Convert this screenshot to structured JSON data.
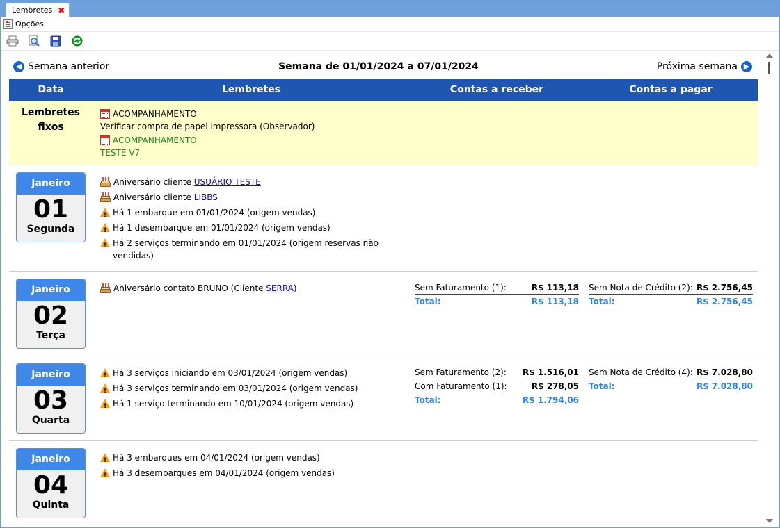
{
  "tab": {
    "label": "Lembretes"
  },
  "menu": {
    "options_label": "Opções"
  },
  "toolbar": {
    "buttons": [
      "print-icon",
      "preview-icon",
      "save-icon",
      "refresh-icon"
    ]
  },
  "nav": {
    "prev_label": "Semana anterior",
    "next_label": "Próxima semana",
    "week_title": "Semana de 01/01/2024 a 07/01/2024"
  },
  "columns": {
    "date": "Data",
    "reminders": "Lembretes",
    "receivables": "Contas a receber",
    "payables": "Contas a pagar"
  },
  "fixed": {
    "label": "Lembretes fixos",
    "items": [
      {
        "title": "ACOMPANHAMENTO",
        "text": "Verificar compra de papel impressora (Observador)"
      },
      {
        "title": "ACOMPANHAMENTO",
        "text": "TESTE V7"
      }
    ]
  },
  "days": [
    {
      "month": "Janeiro",
      "day": "01",
      "weekday": "Segunda",
      "items": [
        {
          "pre": "Aniversário cliente ",
          "link": "USUÁRIO TESTE",
          "post": ""
        },
        {
          "pre": "Aniversário cliente ",
          "link": "LIBBS",
          "post": ""
        },
        {
          "pre": "Há 1 embarque em 01/01/2024 (origem vendas)"
        },
        {
          "pre": "Há 1 desembarque em 01/01/2024 (origem vendas)"
        },
        {
          "pre": "Há 2 serviços terminando em 01/01/2024 (origem reservas não vendidas)"
        }
      ]
    },
    {
      "month": "Janeiro",
      "day": "02",
      "weekday": "Terça",
      "items": [
        {
          "pre": "Aniversário contato BRUNO (Cliente ",
          "link": "SERRA",
          "post": ")"
        }
      ],
      "receivables": [
        {
          "label": "Sem Faturamento (1):",
          "value": "R$ 113,18"
        }
      ],
      "receivables_total": "R$ 113,18",
      "payables": [
        {
          "label": "Sem Nota de Crédito (2):",
          "value": "R$ 2.756,45"
        }
      ],
      "payables_total": "R$ 2.756,45"
    },
    {
      "month": "Janeiro",
      "day": "03",
      "weekday": "Quarta",
      "items": [
        {
          "pre": "Há 3 serviços iniciando em 03/01/2024 (origem vendas)"
        },
        {
          "pre": "Há 3 serviços terminando em 03/01/2024 (origem vendas)"
        },
        {
          "pre": "Há 1 serviço terminando em 10/01/2024 (origem vendas)"
        }
      ],
      "receivables": [
        {
          "label": "Sem Faturamento (2):",
          "value": "R$ 1.516,01"
        },
        {
          "label": "Com Faturamento (1):",
          "value": "R$ 278,05"
        }
      ],
      "receivables_total": "R$ 1.794,06",
      "payables": [
        {
          "label": "Sem Nota de Crédito (4):",
          "value": "R$ 7.028,80"
        }
      ],
      "payables_total": "R$ 7.028,80"
    },
    {
      "month": "Janeiro",
      "day": "04",
      "weekday": "Quinta",
      "items": [
        {
          "pre": "Há 3 embarques em 04/01/2024 (origem vendas)"
        },
        {
          "pre": "Há 3 desembarques em 04/01/2024 (origem vendas)"
        }
      ]
    }
  ],
  "total_label": "Total:"
}
